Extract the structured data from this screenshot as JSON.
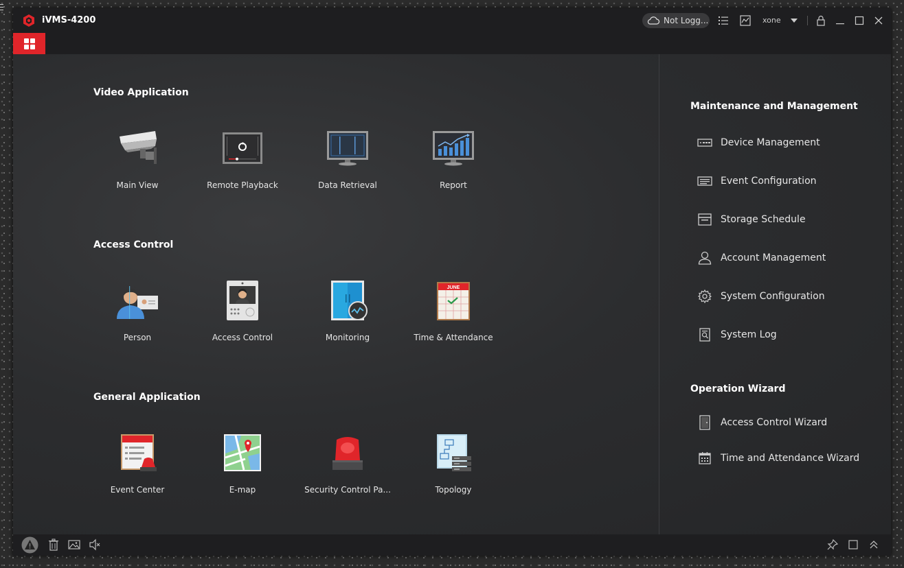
{
  "titlebar": {
    "app_title": "iVMS-4200",
    "cloud_status": "Not Logg...",
    "user": "xone"
  },
  "colors": {
    "accent": "#e0252a",
    "background": "#2c2d2f",
    "titlebar": "#1e1e20"
  },
  "sections": {
    "video": {
      "title": "Video Application",
      "apps": [
        {
          "label": "Main View",
          "icon": "camera-icon"
        },
        {
          "label": "Remote Playback",
          "icon": "playback-icon"
        },
        {
          "label": "Data Retrieval",
          "icon": "monitor-icon"
        },
        {
          "label": "Report",
          "icon": "chart-monitor-icon"
        }
      ]
    },
    "access": {
      "title": "Access Control",
      "apps": [
        {
          "label": "Person",
          "icon": "person-card-icon"
        },
        {
          "label": "Access Control",
          "icon": "door-station-icon"
        },
        {
          "label": "Monitoring",
          "icon": "door-monitor-icon"
        },
        {
          "label": "Time & Attendance",
          "icon": "calendar-icon"
        }
      ]
    },
    "general": {
      "title": "General Application",
      "apps": [
        {
          "label": "Event Center",
          "icon": "event-center-icon"
        },
        {
          "label": "E-map",
          "icon": "map-pin-icon"
        },
        {
          "label": "Security Control Pa...",
          "icon": "alarm-light-icon"
        },
        {
          "label": "Topology",
          "icon": "topology-icon"
        }
      ]
    }
  },
  "maintenance": {
    "title": "Maintenance and Management",
    "items": [
      {
        "label": "Device Management",
        "icon": "device-icon"
      },
      {
        "label": "Event Configuration",
        "icon": "event-config-icon"
      },
      {
        "label": "Storage Schedule",
        "icon": "storage-icon"
      },
      {
        "label": "Account Management",
        "icon": "account-icon"
      },
      {
        "label": "System Configuration",
        "icon": "gear-icon"
      },
      {
        "label": "System Log",
        "icon": "log-icon"
      }
    ]
  },
  "wizard": {
    "title": "Operation Wizard",
    "items": [
      {
        "label": "Access Control Wizard",
        "icon": "door-icon"
      },
      {
        "label": "Time and Attendance Wizard",
        "icon": "calendar-small-icon"
      }
    ]
  }
}
